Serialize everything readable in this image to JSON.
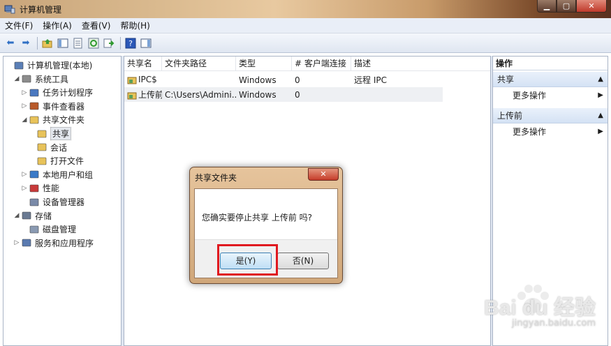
{
  "window": {
    "title": "计算机管理"
  },
  "menu": [
    "文件(F)",
    "操作(A)",
    "查看(V)",
    "帮助(H)"
  ],
  "toolbar_icons": [
    "back-arrow-icon",
    "forward-arrow-icon",
    "up-folder-icon",
    "show-tree-icon",
    "properties-icon",
    "refresh-icon",
    "export-icon",
    "help-icon",
    "action-pane-icon"
  ],
  "tree": [
    {
      "label": "计算机管理(本地)",
      "icon": "computer-management-icon",
      "level": 0,
      "arrow": ""
    },
    {
      "label": "系统工具",
      "icon": "system-tools-icon",
      "level": 1,
      "arrow": "◢"
    },
    {
      "label": "任务计划程序",
      "icon": "task-scheduler-icon",
      "level": 2,
      "arrow": "▷"
    },
    {
      "label": "事件查看器",
      "icon": "event-viewer-icon",
      "level": 2,
      "arrow": "▷"
    },
    {
      "label": "共享文件夹",
      "icon": "shared-folder-icon",
      "level": 2,
      "arrow": "◢"
    },
    {
      "label": "共享",
      "icon": "share-icon",
      "level": 3,
      "arrow": "",
      "selected": true
    },
    {
      "label": "会话",
      "icon": "session-icon",
      "level": 3,
      "arrow": ""
    },
    {
      "label": "打开文件",
      "icon": "open-file-icon",
      "level": 3,
      "arrow": ""
    },
    {
      "label": "本地用户和组",
      "icon": "users-groups-icon",
      "level": 2,
      "arrow": "▷"
    },
    {
      "label": "性能",
      "icon": "performance-icon",
      "level": 2,
      "arrow": "▷"
    },
    {
      "label": "设备管理器",
      "icon": "device-manager-icon",
      "level": 2,
      "arrow": ""
    },
    {
      "label": "存储",
      "icon": "storage-icon",
      "level": 1,
      "arrow": "◢"
    },
    {
      "label": "磁盘管理",
      "icon": "disk-management-icon",
      "level": 2,
      "arrow": ""
    },
    {
      "label": "服务和应用程序",
      "icon": "services-apps-icon",
      "level": 1,
      "arrow": "▷"
    }
  ],
  "list": {
    "columns": [
      "共享名",
      "文件夹路径",
      "类型",
      "# 客户端连接",
      "描述"
    ],
    "rows": [
      {
        "name": "IPC$",
        "path": "",
        "type": "Windows",
        "clients": "0",
        "desc": "远程 IPC"
      },
      {
        "name": "上传前",
        "path": "C:\\Users\\Admini...",
        "type": "Windows",
        "clients": "0",
        "desc": ""
      }
    ]
  },
  "actions": {
    "title": "操作",
    "sections": [
      {
        "label": "共享",
        "item": "更多操作"
      },
      {
        "label": "上传前",
        "item": "更多操作"
      }
    ]
  },
  "dialog": {
    "title": "共享文件夹",
    "message": "您确实要停止共享 上传前 吗?",
    "yes": "是(Y)",
    "no": "否(N)"
  },
  "watermark": {
    "logo": "Bai du 经验",
    "url": "jingyan.baidu.com"
  },
  "colors": {
    "highlight": "#e0191f",
    "title_bar": "#c89b6a",
    "close_button": "#c0392b"
  }
}
